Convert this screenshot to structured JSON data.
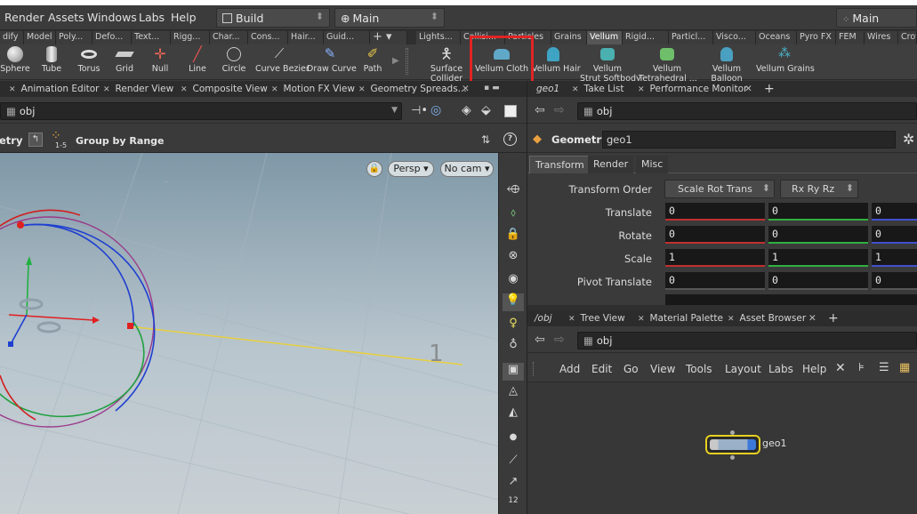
{
  "menubar": {
    "items": [
      "Render",
      "Assets",
      "Windows",
      "Labs",
      "Help"
    ],
    "desktop_dropdown": "Build",
    "context_dropdown": "Main",
    "right_dropdown": "Main"
  },
  "shelf_tabs_left": [
    "dify",
    "Model",
    "Poly...",
    "Defo...",
    "Text...",
    "Rigg...",
    "Char...",
    "Cons...",
    "Hair...",
    "Guid..."
  ],
  "shelf_tabs_right": [
    "Lights...",
    "Collisi...",
    "Particles",
    "Grains",
    "Vellum",
    "Rigid...",
    "Particl...",
    "Visco...",
    "Oceans",
    "Pyro FX",
    "FEM",
    "Wires",
    "Crow"
  ],
  "active_shelf_tab": "Vellum",
  "shelf_tools_left": [
    "Sphere",
    "Tube",
    "Torus",
    "Grid",
    "Null",
    "Line",
    "Circle",
    "Curve Bezier",
    "Draw Curve",
    "Path"
  ],
  "shelf_tools_right": [
    {
      "line1": "Surface",
      "line2": "Collider"
    },
    {
      "line1": "Vellum Cloth",
      "line2": ""
    },
    {
      "line1": "Vellum Hair",
      "line2": ""
    },
    {
      "line1": "Vellum",
      "line2": "Strut Softbody"
    },
    {
      "line1": "Vellum",
      "line2": "Tetrahedral ..."
    },
    {
      "line1": "Vellum",
      "line2": "Balloon"
    },
    {
      "line1": "Vellum Grains",
      "line2": ""
    }
  ],
  "highlight_color": "#e02424",
  "left_pane_tabs": [
    "Animation Editor",
    "Render View",
    "Composite View",
    "Motion FX View",
    "Geometry Spreads..."
  ],
  "right_pane_tabs": [
    "geo1",
    "Take List",
    "Performance Monitor"
  ],
  "viewer": {
    "path": "obj",
    "mode_label": "etry",
    "group_label": "Group by Range",
    "group_badge": "1-5",
    "persp_button": "Persp",
    "cam_button": "No cam",
    "vtool_label": "12"
  },
  "params": {
    "path": "obj",
    "node_type": "Geometry",
    "node_name": "geo1",
    "tabs": [
      "Transform",
      "Render",
      "Misc"
    ],
    "rows": [
      {
        "label": "Transform Order",
        "values": []
      },
      {
        "label": "Translate",
        "values": [
          "0",
          "0",
          "0"
        ]
      },
      {
        "label": "Rotate",
        "values": [
          "0",
          "0",
          "0"
        ]
      },
      {
        "label": "Scale",
        "values": [
          "1",
          "1",
          "1"
        ]
      },
      {
        "label": "Pivot Translate",
        "values": [
          "0",
          "0",
          "0"
        ]
      }
    ],
    "transform_order_1": "Scale Rot Trans",
    "transform_order_2": "Rx Ry Rz"
  },
  "network": {
    "tabs": [
      "/obj",
      "Tree View",
      "Material Palette",
      "Asset Browser"
    ],
    "path": "obj",
    "menu": [
      "Add",
      "Edit",
      "Go",
      "View",
      "Tools",
      "Layout",
      "Labs",
      "Help"
    ],
    "node_label": "geo1"
  }
}
